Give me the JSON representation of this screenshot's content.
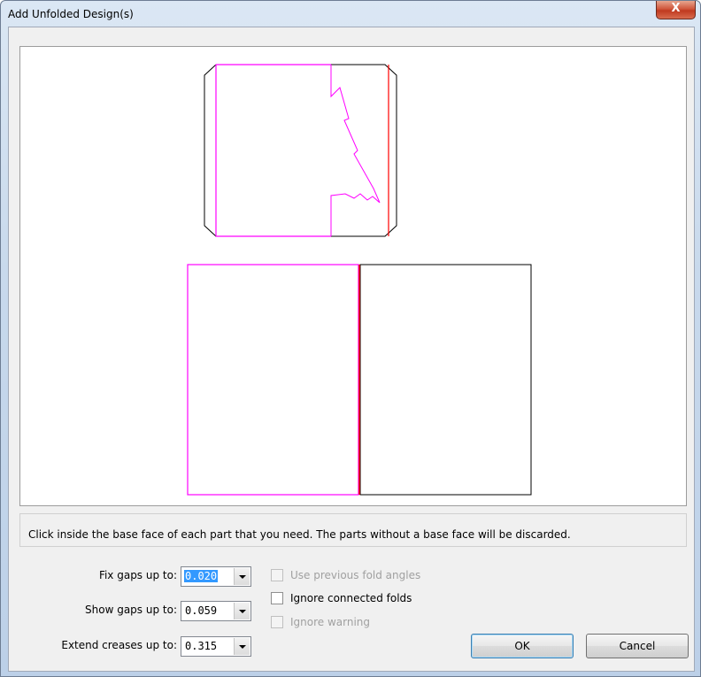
{
  "window": {
    "title": "Add Unfolded Design(s)",
    "close_symbol": "X"
  },
  "status": {
    "message": "Click inside the base face of each part that you need. The parts without a base face will be discarded."
  },
  "options": {
    "fix_gaps": {
      "label": "Fix gaps up to:",
      "value": "0.020"
    },
    "show_gaps": {
      "label": "Show gaps up to:",
      "value": "0.059"
    },
    "extend_creases": {
      "label": "Extend creases up to:",
      "value": "0.315"
    }
  },
  "checkboxes": {
    "use_previous": {
      "label": "Use previous fold angles",
      "checked": false,
      "enabled": false
    },
    "ignore_connected": {
      "label": "Ignore connected folds",
      "checked": false,
      "enabled": true
    },
    "ignore_warning": {
      "label": "Ignore warning",
      "checked": false,
      "enabled": false
    }
  },
  "buttons": {
    "ok": "OK",
    "cancel": "Cancel"
  },
  "colors": {
    "cut_line": "#000000",
    "fold_line": "#ff00ff",
    "crease_line": "#ff0000"
  }
}
